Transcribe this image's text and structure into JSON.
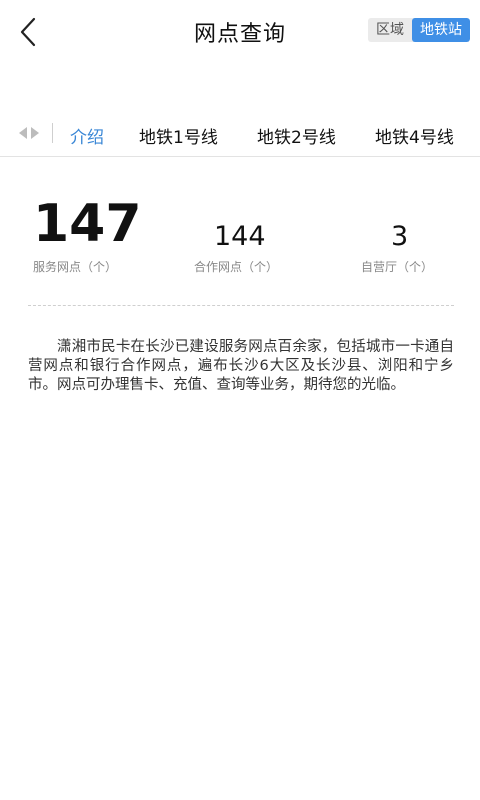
{
  "header": {
    "title": "网点查询",
    "segments": [
      "区域",
      "地铁站"
    ],
    "active_segment": "地铁站"
  },
  "tabs": {
    "items": [
      "介绍",
      "地铁1号线",
      "地铁2号线",
      "地铁4号线"
    ],
    "active": "介绍"
  },
  "stats": [
    {
      "value": "147",
      "label": "服务网点（个）"
    },
    {
      "value": "144",
      "label": "合作网点（个）"
    },
    {
      "value": "3",
      "label": "自营厅（个）"
    }
  ],
  "description": "潇湘市民卡在长沙已建设服务网点百余家，包括城市一卡通自营网点和银行合作网点，遍布长沙6大区及长沙县、浏阳和宁乡市。网点可办理售卡、充值、查询等业务，期待您的光临。",
  "colors": {
    "accent": "#3f8fe6",
    "active_tab": "#3a87d6"
  }
}
